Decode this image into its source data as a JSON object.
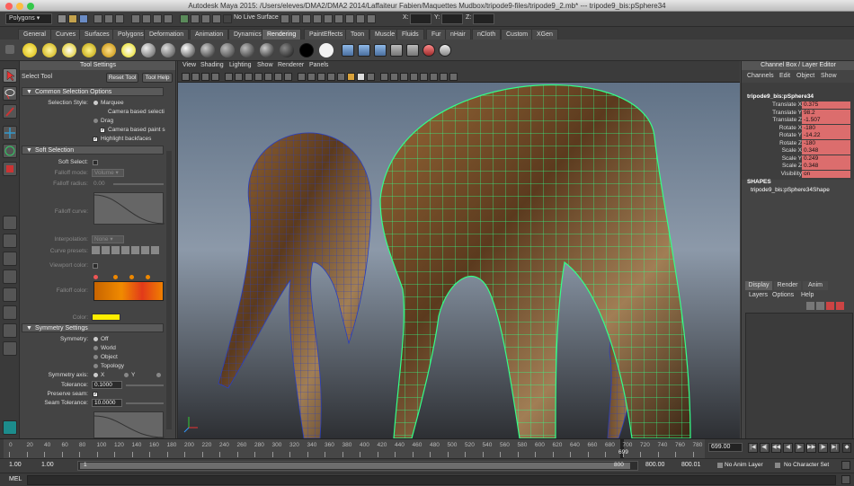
{
  "window": {
    "title": "Autodesk Maya 2015: /Users/eleves/DMA2/DMA2 2014/Laffaiteur Fabien/Maquettes Mudbox/tripode9-files/tripode9_2.mb*  ---  tripode9_bis:pSphere34"
  },
  "status_line": {
    "mode": "Polygons",
    "live_surface": "No Live Surface",
    "x_label": "X:",
    "y_label": "Y:",
    "z_label": "Z:"
  },
  "shelf_tabs": [
    "General",
    "Curves",
    "Surfaces",
    "Polygons",
    "Deformation",
    "Animation",
    "Dynamics",
    "Rendering",
    "PaintEffects",
    "Toon",
    "Muscle",
    "Fluids",
    "Fur",
    "nHair",
    "nCloth",
    "Custom",
    "XGen"
  ],
  "active_shelf_tab": "Rendering",
  "tool_settings": {
    "panel_title": "Tool Settings",
    "tool_name": "Select Tool",
    "reset_button": "Reset Tool",
    "help_button": "Tool Help",
    "common_selection": {
      "header": "Common Selection Options",
      "style_label": "Selection Style:",
      "marquee": "Marquee",
      "camera_based_selection": "Camera based selecti",
      "drag": "Drag",
      "camera_based_paint": "Camera based paint s",
      "highlight_backfaces": "Highlight backfaces"
    },
    "soft_selection": {
      "header": "Soft Selection",
      "soft_select_label": "Soft Select:",
      "falloff_mode_label": "Falloff mode:",
      "falloff_mode_value": "Volume",
      "falloff_radius_label": "Falloff radius:",
      "falloff_radius_value": "0.00",
      "falloff_curve_label": "Falloff curve:",
      "interpolation_label": "Interpolation:",
      "interpolation_value": "None",
      "curve_presets_label": "Curve presets:",
      "viewport_color_label": "Viewport color:",
      "falloff_color_label": "Falloff color:",
      "color_label": "Color:"
    },
    "symmetry": {
      "header": "Symmetry Settings",
      "symmetry_label": "Symmetry:",
      "options": [
        "Off",
        "World",
        "Object",
        "Topology"
      ],
      "axis_label": "Symmetry axis:",
      "axes": [
        "X",
        "Y"
      ],
      "tolerance_label": "Tolerance:",
      "tolerance_value": "0.1000",
      "preserve_seam_label": "Preserve seam:",
      "seam_tolerance_label": "Seam Tolerance:",
      "seam_tolerance_value": "10.0000"
    }
  },
  "viewport": {
    "menu": [
      "View",
      "Shading",
      "Lighting",
      "Show",
      "Renderer",
      "Panels"
    ]
  },
  "channel_box": {
    "title": "Channel Box / Layer Editor",
    "menu": [
      "Channels",
      "Edit",
      "Object",
      "Show"
    ],
    "object_name": "tripode9_bis:pSphere34",
    "channels": [
      {
        "label": "Translate X",
        "value": "0.375"
      },
      {
        "label": "Translate Y",
        "value": "98.2"
      },
      {
        "label": "Translate Z",
        "value": "-1.507"
      },
      {
        "label": "Rotate X",
        "value": "-180"
      },
      {
        "label": "Rotate Y",
        "value": "-14.22"
      },
      {
        "label": "Rotate Z",
        "value": "-180"
      },
      {
        "label": "Scale X",
        "value": "0.348"
      },
      {
        "label": "Scale Y",
        "value": "0.249"
      },
      {
        "label": "Scale Z",
        "value": "0.348"
      },
      {
        "label": "Visibility",
        "value": "on"
      }
    ],
    "shapes_header": "SHAPES",
    "shape_name": "tripode9_bis:pSphere34Shape",
    "layer_tabs": [
      "Display",
      "Render",
      "Anim"
    ],
    "layer_menu": [
      "Layers",
      "Options",
      "Help"
    ]
  },
  "timeline": {
    "ticks": [
      "0",
      "20",
      "40",
      "60",
      "80",
      "100",
      "120",
      "140",
      "160",
      "180",
      "200",
      "220",
      "240",
      "260",
      "280",
      "300",
      "320",
      "340",
      "360",
      "380",
      "400",
      "420",
      "440",
      "460",
      "480",
      "500",
      "520",
      "540",
      "560",
      "580",
      "600",
      "620",
      "640",
      "660",
      "680",
      "700",
      "720",
      "740",
      "760",
      "780"
    ],
    "current_frame": "699.00",
    "playhead_label": "699"
  },
  "range_slider": {
    "start_outer": "1.00",
    "start_inner": "1.00",
    "range_start": "1",
    "range_end": "800",
    "end_inner": "800.00",
    "end_outer": "800.01",
    "anim_layer": "No Anim Layer",
    "character_set": "No Character Set"
  },
  "command_line": {
    "label": "MEL"
  },
  "colors": {
    "viewport_top": "#5b6d82",
    "wireframe_selected": "#33ff88",
    "wireframe": "#2a3fbf",
    "channel_keyed": "#dc6d6d",
    "falloff_yellow": "#ffee00"
  }
}
